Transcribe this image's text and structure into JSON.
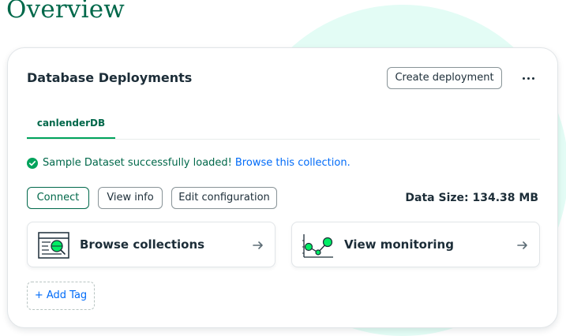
{
  "page": {
    "title": "Overview"
  },
  "card": {
    "title": "Database Deployments",
    "create_label": "Create deployment",
    "more_icon": "ellipsis-icon"
  },
  "tabs": [
    {
      "label": "canlenderDB",
      "active": true
    }
  ],
  "status": {
    "message": "Sample Dataset successfully loaded!",
    "link": "Browse this collection.",
    "icon": "check-circle-icon"
  },
  "actions": {
    "connect": "Connect",
    "view_info": "View info",
    "edit_config": "Edit configuration"
  },
  "data_size": "Data Size: 134.38 MB",
  "tiles": [
    {
      "label": "Browse collections",
      "icon": "browse-collections-icon"
    },
    {
      "label": "View monitoring",
      "icon": "monitoring-chart-icon"
    }
  ],
  "add_tag": "+ Add Tag",
  "colors": {
    "brand_green": "#00684a",
    "accent_green": "#00ed64",
    "link_blue": "#016bf8",
    "background_blob": "#e3fcf5"
  }
}
